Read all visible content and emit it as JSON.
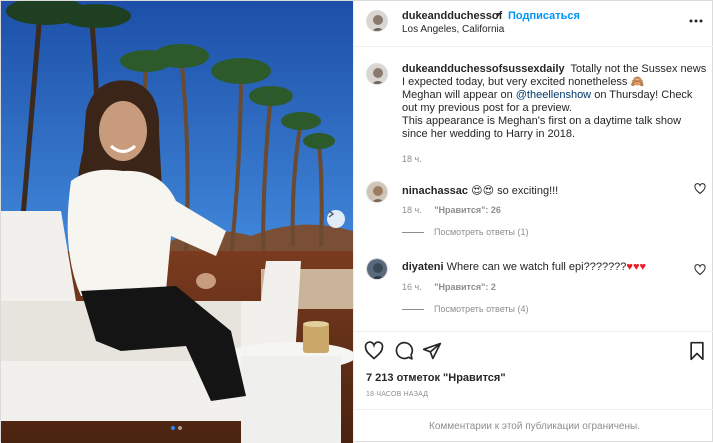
{
  "post": {
    "author": "dukeandduchessof",
    "follow_label": "Подписаться",
    "separator": "•",
    "location": "Los Angeles, California"
  },
  "caption": {
    "username": "dukeandduchessofsussexdaily",
    "line1": "Totally not the Sussex news I expected today, but very excited nonetheless 🙈",
    "line2_before": "Meghan will appear on ",
    "mention": "@theellenshow",
    "line2_after": " on Thursday! Check out my previous post for a preview.",
    "line3": "This appearance is Meghan's first on a daytime talk show since her wedding to Harry in 2018.",
    "time": "18 ч."
  },
  "comments": [
    {
      "username": "ninachassac",
      "text": "😍😍 so exciting!!!",
      "time": "18 ч.",
      "likes": "\"Нравится\": 26",
      "replies": "Посмотреть ответы (1)"
    },
    {
      "username": "diyateni",
      "text": "Where can we watch full epi???????",
      "hearts": "♥♥♥",
      "time": "16 ч.",
      "likes": "\"Нравится\": 2",
      "replies": "Посмотреть ответы (4)"
    }
  ],
  "actions": {
    "like_icon": "heart-icon",
    "comment_icon": "comment-icon",
    "share_icon": "paper-plane-icon",
    "save_icon": "bookmark-icon"
  },
  "likes_count": "7 213 отметок \"Нравится\"",
  "post_time": "18 ЧАСОВ НАЗАД",
  "comments_disabled": "Комментарии к этой публикации ограничены.",
  "colors": {
    "accent": "#0095f6",
    "text": "#262626",
    "muted": "#8e8e8e",
    "border": "#efefef"
  }
}
